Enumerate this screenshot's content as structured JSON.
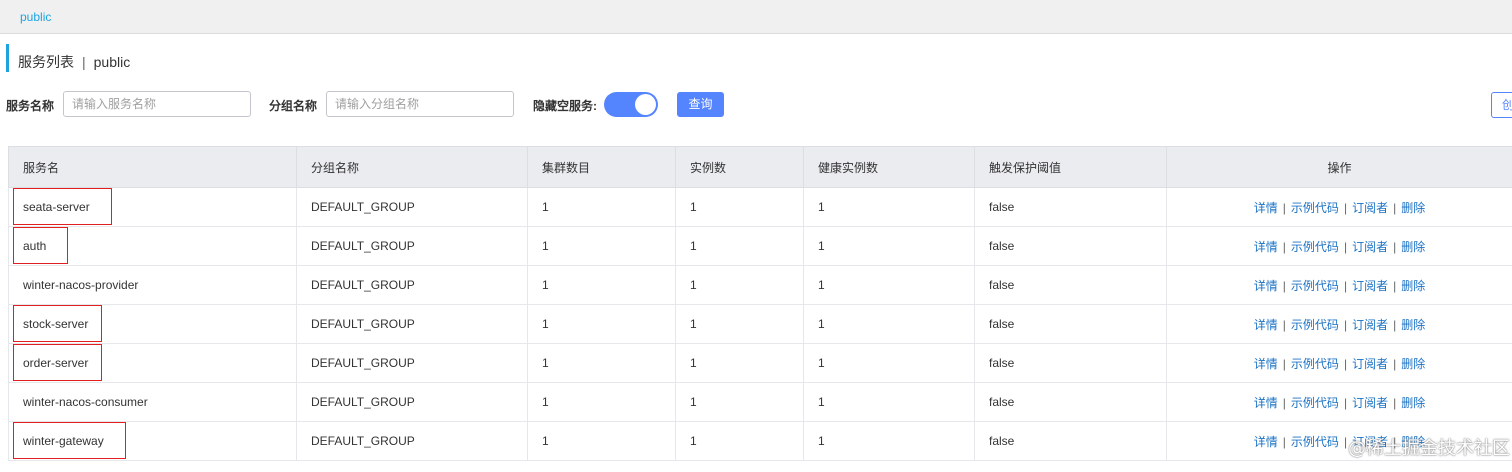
{
  "namespace_tab": "public",
  "page_title": {
    "main": "服务列表",
    "separator": "|",
    "namespace": "public"
  },
  "filters": {
    "service_name_label": "服务名称",
    "service_name_placeholder": "请输入服务名称",
    "service_name_value": "",
    "group_name_label": "分组名称",
    "group_name_placeholder": "请输入分组名称",
    "group_name_value": "",
    "hide_empty_label": "隐藏空服务:",
    "hide_empty_enabled": true,
    "query_button": "查询",
    "create_button": "创"
  },
  "table": {
    "columns": [
      "服务名",
      "分组名称",
      "集群数目",
      "实例数",
      "健康实例数",
      "触发保护阈值",
      "操作"
    ],
    "actions": [
      "详情",
      "示例代码",
      "订阅者",
      "删除"
    ],
    "action_separator": "|",
    "rows": [
      {
        "name": "seata-server",
        "group": "DEFAULT_GROUP",
        "clusters": "1",
        "instances": "1",
        "healthy": "1",
        "threshold": "false",
        "highlighted": true
      },
      {
        "name": "auth",
        "group": "DEFAULT_GROUP",
        "clusters": "1",
        "instances": "1",
        "healthy": "1",
        "threshold": "false",
        "highlighted": true
      },
      {
        "name": "winter-nacos-provider",
        "group": "DEFAULT_GROUP",
        "clusters": "1",
        "instances": "1",
        "healthy": "1",
        "threshold": "false",
        "highlighted": false
      },
      {
        "name": "stock-server",
        "group": "DEFAULT_GROUP",
        "clusters": "1",
        "instances": "1",
        "healthy": "1",
        "threshold": "false",
        "highlighted": true
      },
      {
        "name": "order-server",
        "group": "DEFAULT_GROUP",
        "clusters": "1",
        "instances": "1",
        "healthy": "1",
        "threshold": "false",
        "highlighted": true
      },
      {
        "name": "winter-nacos-consumer",
        "group": "DEFAULT_GROUP",
        "clusters": "1",
        "instances": "1",
        "healthy": "1",
        "threshold": "false",
        "highlighted": false
      },
      {
        "name": "winter-gateway",
        "group": "DEFAULT_GROUP",
        "clusters": "1",
        "instances": "1",
        "healthy": "1",
        "threshold": "false",
        "highlighted": true
      }
    ]
  },
  "watermark": "@稀土掘金技术社区",
  "colors": {
    "accent": "#1da4e0",
    "primary": "#5584ff",
    "link": "#1b72c4",
    "highlight_box": "#e02020"
  }
}
